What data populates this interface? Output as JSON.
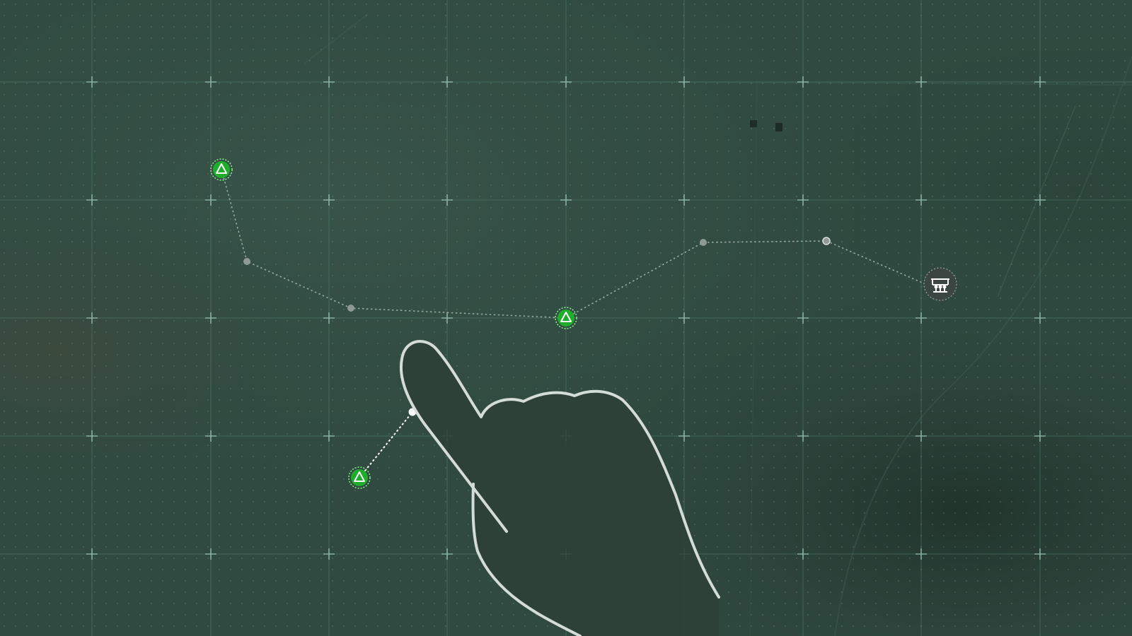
{
  "scene": {
    "colors": {
      "terrain_base": "#304a41",
      "terrain_dark": "#23372f",
      "terrain_light": "#3f5a50",
      "grid_line": "#5f8c7c",
      "grid_cross": "#9cc6b6",
      "dot_grid": "#6f9585",
      "route_line": "#b8c7c0",
      "waypoint_dot": "#8f9a95",
      "squad_green": "#1fae2c",
      "squad_ring": "#8ff08f",
      "hand_outline": "#d3dcd7",
      "hand_fill": "#2e4038",
      "objective_bg": "#3d4541"
    }
  },
  "map": {
    "squad_markers": [
      {
        "name": "squad-marker-north",
        "icon": "triangle-up-icon"
      },
      {
        "name": "squad-marker-center",
        "icon": "triangle-up-icon"
      },
      {
        "name": "squad-marker-south",
        "icon": "triangle-up-icon"
      }
    ],
    "route_waypoints": [
      {
        "name": "route-waypoint-1"
      },
      {
        "name": "route-waypoint-2"
      },
      {
        "name": "route-waypoint-3"
      },
      {
        "name": "route-waypoint-4"
      }
    ],
    "drag_target": {
      "name": "drag-target-point"
    },
    "objective": {
      "name": "objective-marker",
      "icon": "fortification-icon"
    },
    "tutorial_hand": {
      "name": "tutorial-hand-pointer",
      "icon": "hand-pointer-icon"
    }
  }
}
